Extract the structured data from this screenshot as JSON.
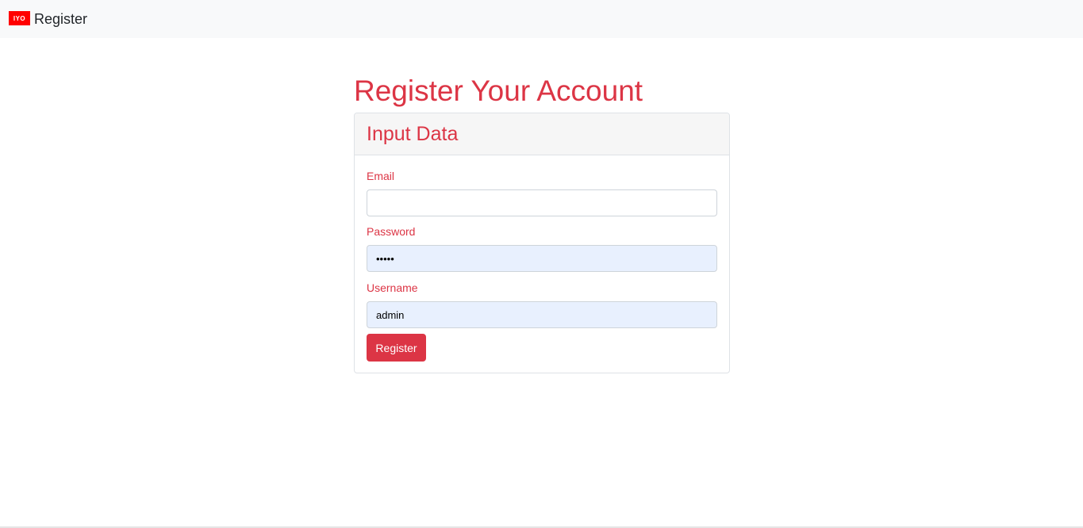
{
  "navbar": {
    "logo_text": "IYO",
    "brand": "Register"
  },
  "page": {
    "title": "Register Your Account"
  },
  "card": {
    "header": "Input Data",
    "fields": {
      "email": {
        "label": "Email",
        "value": ""
      },
      "password": {
        "label": "Password",
        "value": "•••••"
      },
      "username": {
        "label": "Username",
        "value": "admin"
      }
    },
    "submit_label": "Register"
  },
  "colors": {
    "accent": "#dc3545",
    "navbar_bg": "#f8f9fa",
    "autofill_bg": "#e8f0fe",
    "logo_red": "#ff0000"
  }
}
